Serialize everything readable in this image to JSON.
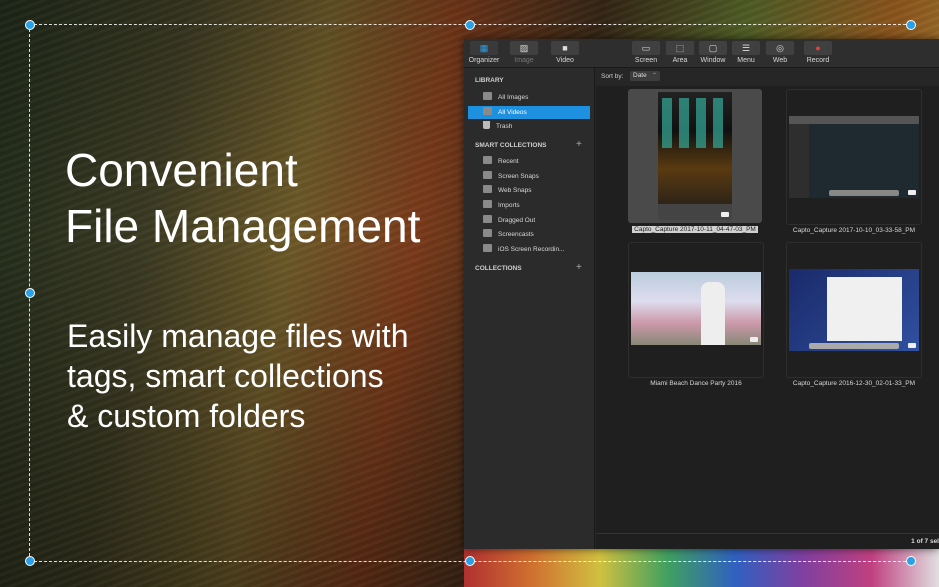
{
  "marketing": {
    "headline_line1": "Convenient",
    "headline_line2": "File Management",
    "sub_line1": "Easily manage files with",
    "sub_line2": "tags, smart collections",
    "sub_line3": "& custom folders"
  },
  "toolbar": {
    "organizer": "Organizer",
    "image": "Image",
    "video": "Video",
    "screen": "Screen",
    "area": "Area",
    "window": "Window",
    "menu": "Menu",
    "web": "Web",
    "record": "Record"
  },
  "sidebar": {
    "library_header": "LIBRARY",
    "library_items": [
      "All Images",
      "All Videos",
      "Trash"
    ],
    "smart_header": "SMART COLLECTIONS",
    "smart_items": [
      "Recent",
      "Screen Snaps",
      "Web Snaps",
      "Imports",
      "Dragged Out",
      "Screencasts",
      "iOS Screen Recordin..."
    ],
    "collections_header": "COLLECTIONS"
  },
  "main": {
    "sort_label": "Sort by:",
    "sort_value": "Date",
    "items": [
      "Capto_Capture 2017-10-11_04-47-03_PM",
      "Capto_Capture 2017-10-10_03-33-58_PM",
      "Miami Beach Dance Party 2016",
      "Capto_Capture 2016-12-30_02-01-33_PM"
    ],
    "status": "1 of 7 sel"
  },
  "colors": {
    "accent": "#1e90e0",
    "handle": "#2aa0e8"
  }
}
